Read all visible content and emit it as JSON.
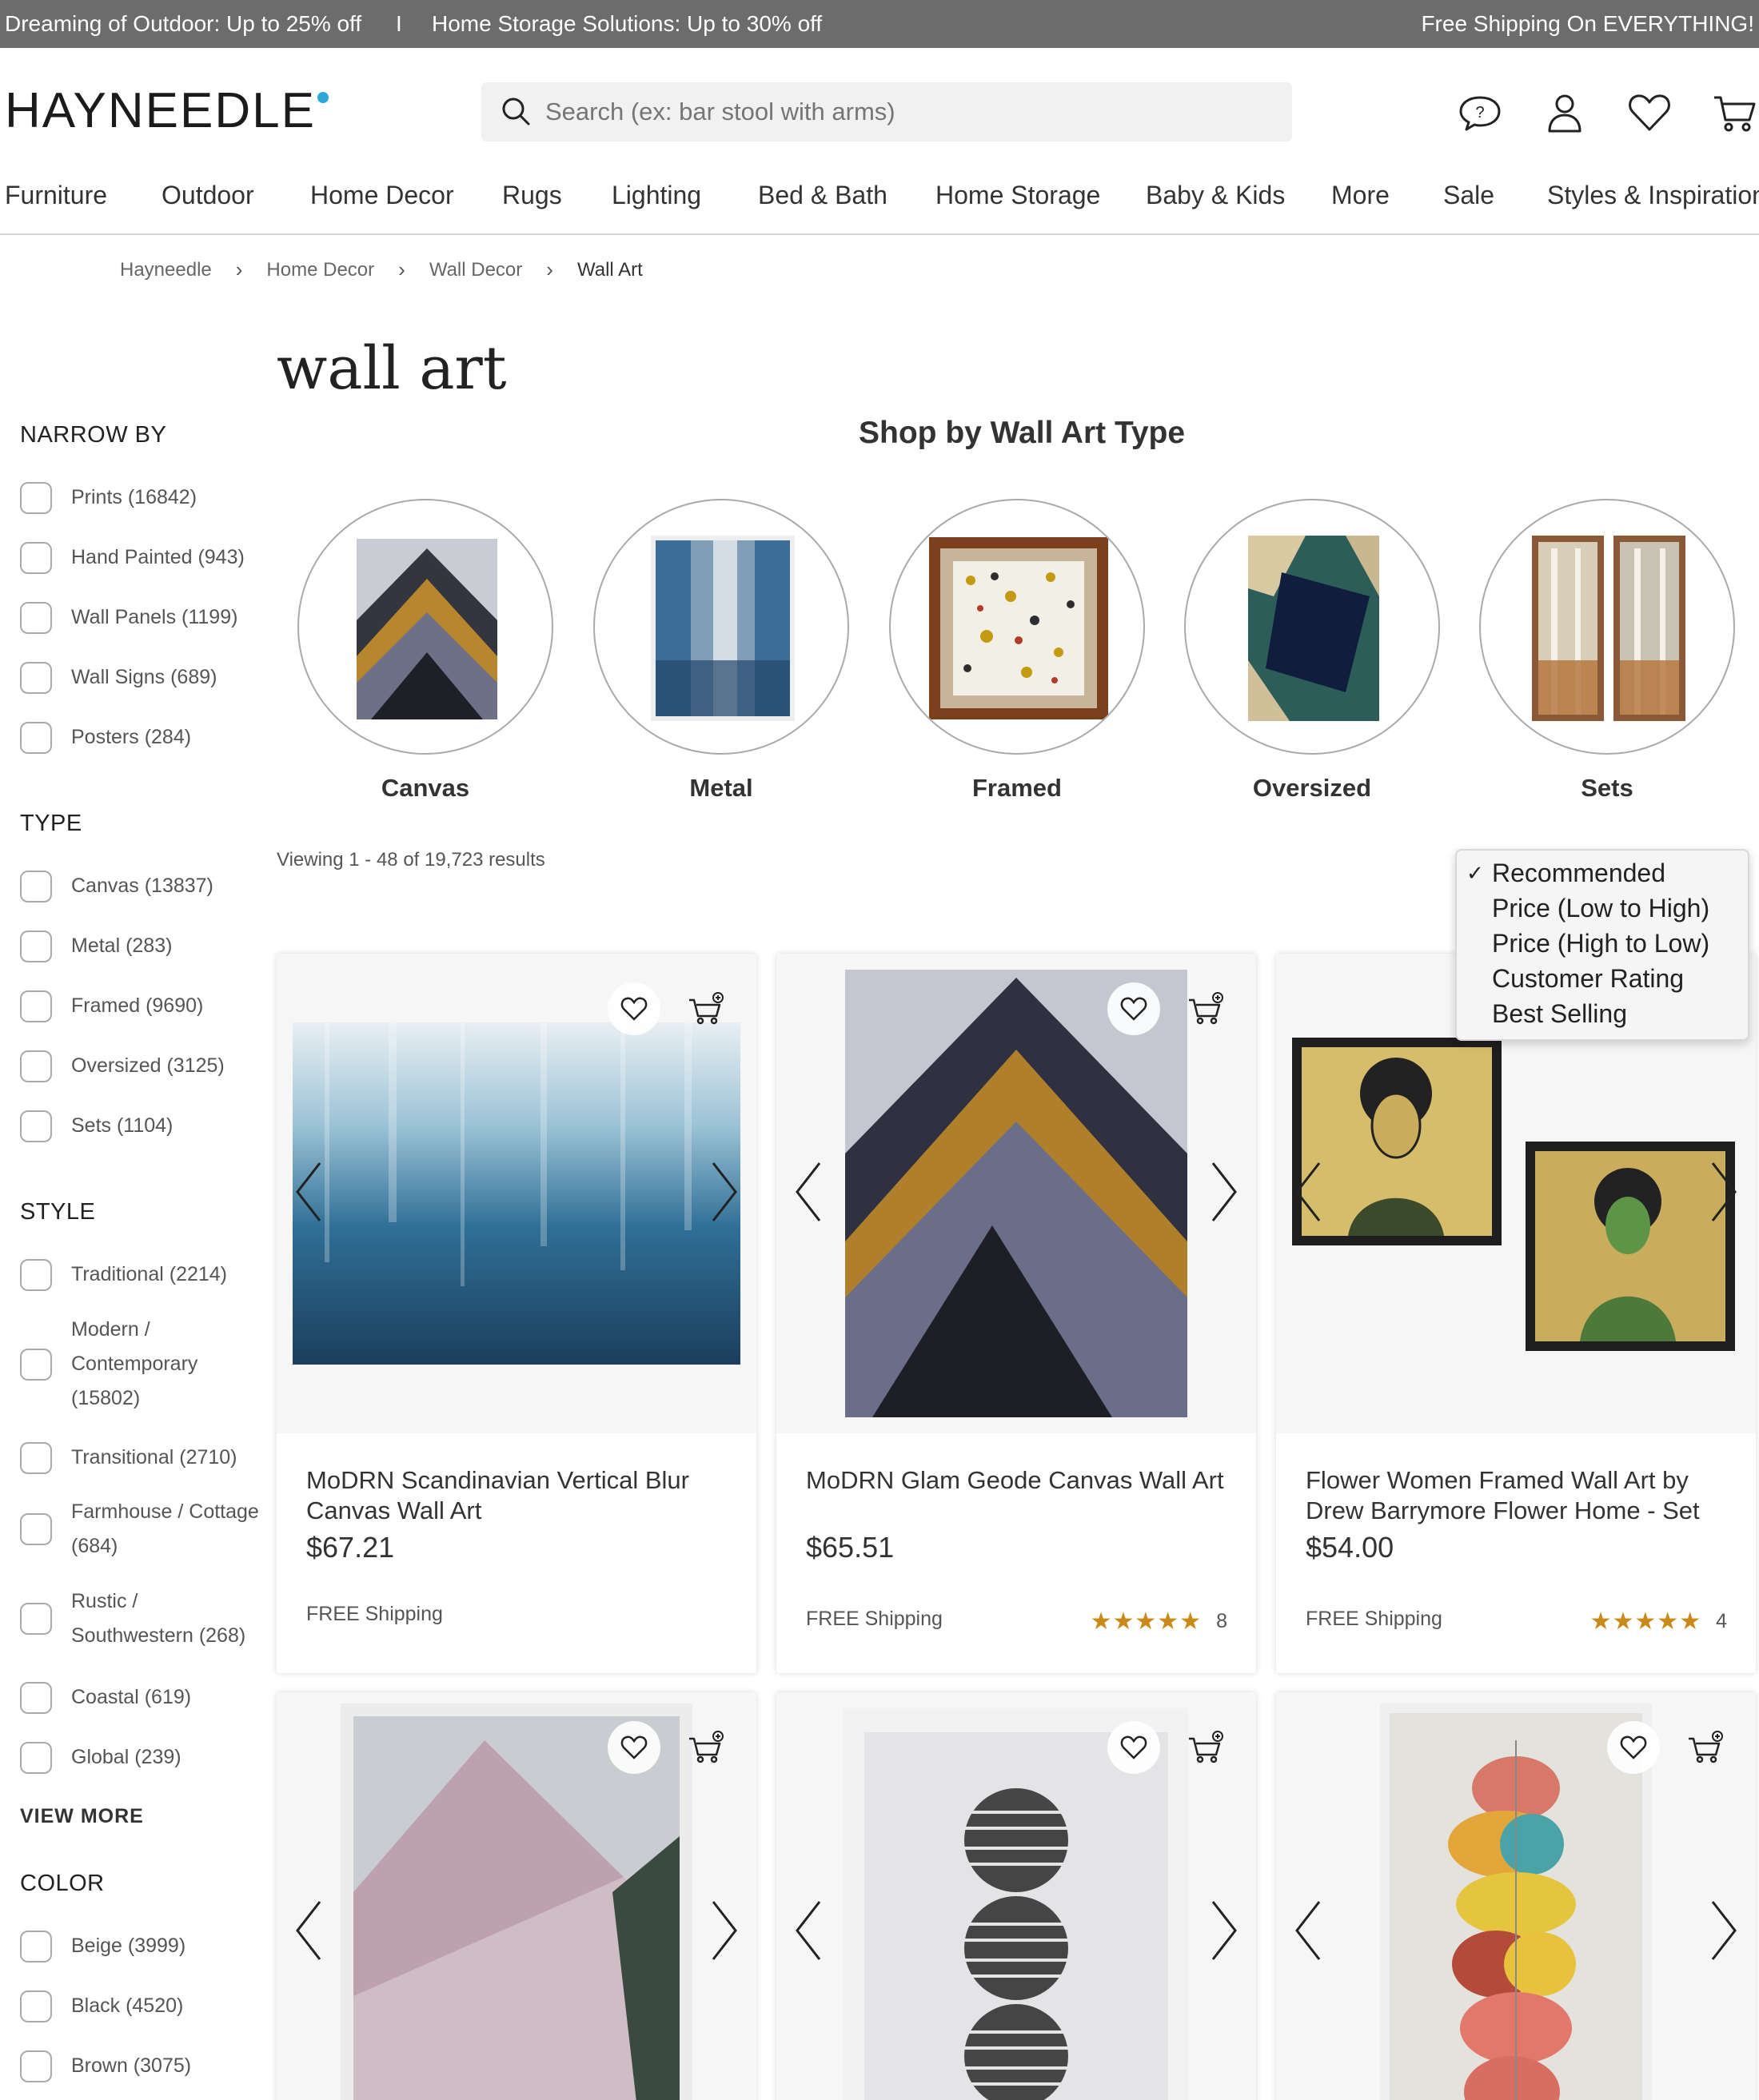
{
  "promo": {
    "left1": "Dreaming of Outdoor: Up to 25% off",
    "separator": "I",
    "left2": "Home Storage Solutions: Up to 30% off",
    "right": "Free Shipping On EVERYTHING!"
  },
  "header": {
    "logo": "HAYNEEDLE",
    "search_placeholder": "Search (ex: bar stool with arms)",
    "icons": [
      "help-chat-icon",
      "account-icon",
      "heart-icon",
      "cart-icon"
    ]
  },
  "nav": [
    "Furniture",
    "Outdoor",
    "Home Decor",
    "Rugs",
    "Lighting",
    "Bed & Bath",
    "Home Storage",
    "Baby & Kids",
    "More",
    "Sale",
    "Styles & Inspiration"
  ],
  "breadcrumb": [
    "Hayneedle",
    "Home Decor",
    "Wall Decor",
    "Wall Art"
  ],
  "page_title": "wall art",
  "sidebar": {
    "narrow_title": "NARROW BY",
    "narrow_items": [
      "Prints (16842)",
      "Hand Painted (943)",
      "Wall Panels (1199)",
      "Wall Signs (689)",
      "Posters (284)"
    ],
    "type_title": "TYPE",
    "type_items": [
      "Canvas (13837)",
      "Metal (283)",
      "Framed (9690)",
      "Oversized (3125)",
      "Sets (1104)"
    ],
    "style_title": "STYLE",
    "style_items": [
      "Traditional (2214)",
      "Modern / Contemporary (15802)",
      "Transitional (2710)",
      "Farmhouse / Cottage (684)",
      "Rustic / Southwestern (268)",
      "Coastal (619)",
      "Global (239)"
    ],
    "view_more": "VIEW MORE",
    "color_title": "COLOR",
    "color_items": [
      "Beige (3999)",
      "Black (4520)",
      "Brown (3075)"
    ]
  },
  "shop_by_type": {
    "title": "Shop by Wall Art Type",
    "items": [
      "Canvas",
      "Metal",
      "Framed",
      "Oversized",
      "Sets"
    ]
  },
  "results": {
    "viewing": "Viewing 1 - 48 of 19,723 results"
  },
  "sort": {
    "options": [
      "Recommended",
      "Price (Low to High)",
      "Price (High to Low)",
      "Customer Rating",
      "Best Selling"
    ],
    "selected": "Recommended",
    "check": "✓"
  },
  "products": [
    {
      "name": "MoDRN Scandinavian Vertical Blur Canvas Wall Art",
      "price": "$67.21",
      "shipping": "FREE Shipping",
      "stars": "",
      "reviews": ""
    },
    {
      "name": "MoDRN Glam Geode Canvas Wall Art",
      "price": "$65.51",
      "shipping": "FREE Shipping",
      "stars": "★★★★★",
      "reviews": "8"
    },
    {
      "name": "Flower Women Framed Wall Art by Drew Barrymore Flower Home - Set …",
      "price": "$54.00",
      "shipping": "FREE Shipping",
      "stars": "★★★★★",
      "reviews": "4"
    }
  ],
  "colors": {
    "promo_bg": "#6c6c6c",
    "accent_dot": "#2aa9d8",
    "star": "#c98a1a"
  }
}
